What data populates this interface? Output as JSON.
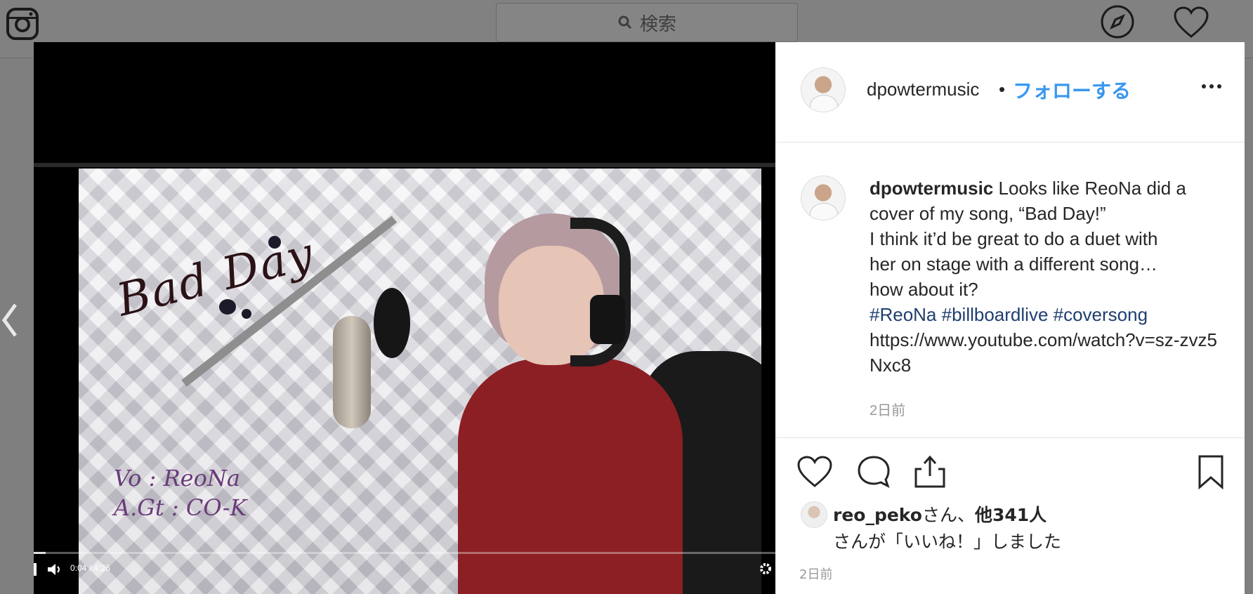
{
  "topbar": {
    "logo_icon": "instagram-icon",
    "search_placeholder": "検索",
    "explore_icon": "compass-icon",
    "activity_icon": "heart-icon"
  },
  "media": {
    "video_title_text": "Bad Day",
    "credits": [
      "Vo : ReoNa",
      "A.Gt : CO-K"
    ],
    "player": {
      "time": "0:04 / 4:26",
      "progress": 0.0157
    }
  },
  "post": {
    "username": "dpowtermusic",
    "separator": "•",
    "follow_label": "フォローする",
    "caption_lines": [
      "Looks like ReoNa did a",
      "cover of my song, “Bad Day!”",
      "I think it’d be great to do a duet with",
      "her on stage with a different song…",
      "how about it?"
    ],
    "hashtags": [
      "#ReoNa",
      "#billboardlive",
      "#coversong"
    ],
    "link": "https://www.youtube.com/watch?v=sz-zvz5Nxc8",
    "caption_time": "2日前",
    "likes": {
      "user": "reo_peko",
      "suffix": "さん、",
      "others": "他341人",
      "line2": "さんが「いいね！」しました"
    },
    "post_time": "2日前"
  }
}
